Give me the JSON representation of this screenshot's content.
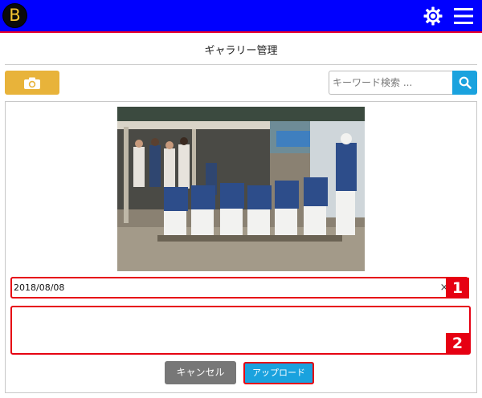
{
  "header": {
    "logo_letter": "B",
    "logo_icon": "b-logo-icon",
    "settings_icon": "gear-icon",
    "menu_icon": "hamburger-menu-icon",
    "bar_color": "#0000ff",
    "accent_line_color": "#e8002a"
  },
  "page": {
    "title": "ギャラリー管理"
  },
  "toolbar": {
    "camera_icon": "camera-icon",
    "camera_button_color": "#e8b33a",
    "search_placeholder": "キーワード検索 ...",
    "search_value": "",
    "search_icon": "magnifier-icon",
    "search_button_color": "#1aa2de"
  },
  "form": {
    "photo_subject": "baseball team huddle",
    "date_value": "2018/08/08",
    "clear_label": "×",
    "comment_value": "",
    "highlight_color": "#e60012",
    "markers": [
      "1",
      "2"
    ]
  },
  "actions": {
    "cancel_label": "キャンセル",
    "upload_label": "アップロード",
    "cancel_color": "#777777",
    "upload_color": "#1aa2de"
  }
}
